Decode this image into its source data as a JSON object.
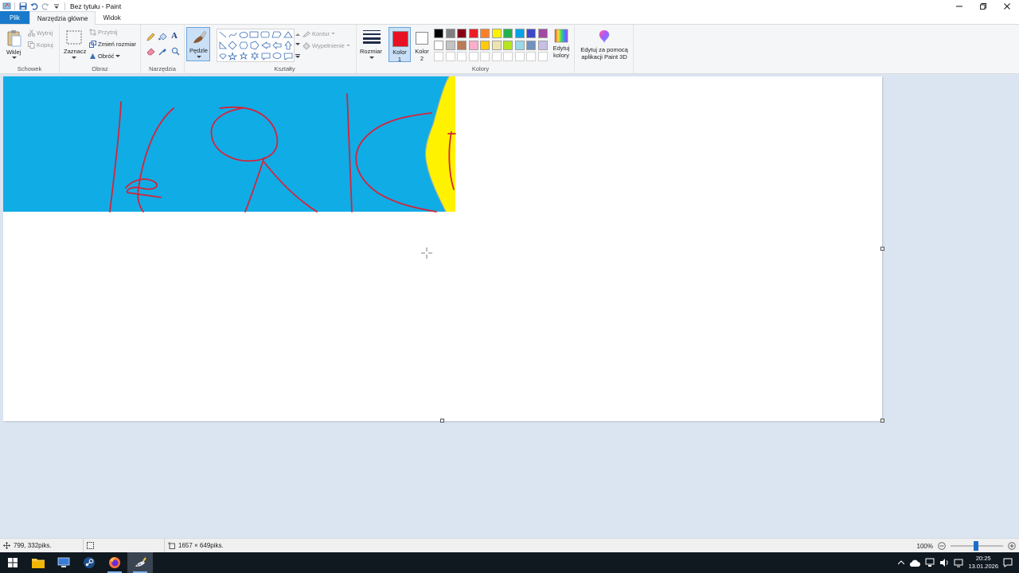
{
  "window": {
    "title": "Bez tytułu - Paint",
    "controls": [
      "minimize-icon",
      "maximize-icon",
      "close-icon"
    ]
  },
  "tabs": [
    {
      "label": "Plik"
    },
    {
      "label": "Narzędzia główne"
    },
    {
      "label": "Widok"
    }
  ],
  "ribbon": {
    "clipboard": {
      "paste": "Wklej",
      "cut": "Wytnij",
      "copy": "Kopiuj",
      "group": "Schowek"
    },
    "image": {
      "select": "Zaznacz",
      "crop": "Przytnij",
      "resize": "Zmień rozmiar",
      "rotate": "Obróć",
      "group": "Obraz"
    },
    "tools": {
      "group": "Narzędzia"
    },
    "brushes": {
      "label": "Pędzle"
    },
    "shapes": {
      "outline": "Kontur",
      "fill": "Wypełnienie",
      "group": "Kształty"
    },
    "size": {
      "label": "Rozmiar"
    },
    "colors": {
      "color1": "Kolor 1",
      "color1_line1": "Kolor",
      "color1_line2": "1",
      "color2_line1": "Kolor",
      "color2_line2": "2",
      "edit": "Edytuj kolory",
      "edit_line1": "Edytuj",
      "edit_line2": "kolory",
      "group": "Kolory",
      "color1_value": "#e81123",
      "color2_value": "#ffffff",
      "palette_row1": [
        "#000000",
        "#7f7f7f",
        "#880015",
        "#ed1c24",
        "#ff7f27",
        "#fff200",
        "#22b14c",
        "#00a2e8",
        "#3f48cc",
        "#a349a4"
      ],
      "palette_row2": [
        "#ffffff",
        "#c3c3c3",
        "#b97a57",
        "#ffaec9",
        "#ffc90e",
        "#efe4b0",
        "#b5e61d",
        "#99d9ea",
        "#7092be",
        "#c8bfe7"
      ]
    },
    "paint3d": {
      "line1": "Edytuj za pomocą",
      "line2": "aplikacji Paint 3D"
    }
  },
  "status": {
    "cursor_pos": "799, 332piks.",
    "canvas_size": "1657 × 649piks.",
    "zoom": "100%"
  },
  "taskbar": {
    "time": "20:25",
    "date": "13.01.2026"
  }
}
